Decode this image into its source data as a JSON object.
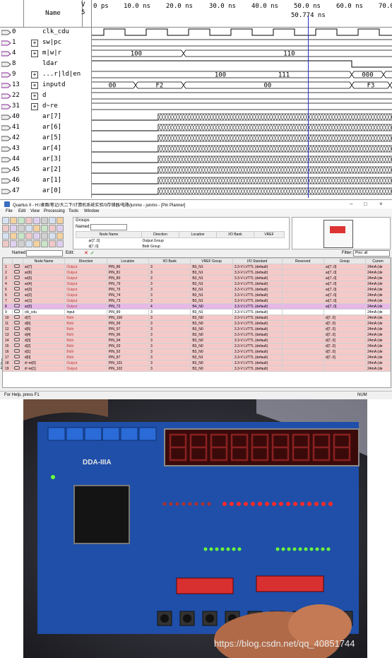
{
  "waveform": {
    "header": {
      "name_label": "Name",
      "value_label_1": "V",
      "value_label_2": "5"
    },
    "time_ticks": [
      "0 ps",
      "10.0 ns",
      "20.0 ns",
      "30.0 ns",
      "40.0 ns",
      "50.0 ns",
      "60.0 ns",
      "70.0"
    ],
    "cursor_label": "50.774 ns",
    "signals": [
      {
        "index": "0",
        "name": "clk_cdu",
        "expand": false,
        "values": []
      },
      {
        "index": "1",
        "name": "sw|pc",
        "expand": true,
        "values": []
      },
      {
        "index": "4",
        "name": "m|w|r",
        "expand": true,
        "values": [
          "100",
          "110"
        ]
      },
      {
        "index": "8",
        "name": "ldar",
        "expand": false,
        "values": []
      },
      {
        "index": "9",
        "name": "...r|ld|en",
        "expand": true,
        "values": [
          "100",
          "111",
          "000"
        ]
      },
      {
        "index": "13",
        "name": "inputd",
        "expand": true,
        "values": [
          "00",
          "F2",
          "00",
          "F3"
        ]
      },
      {
        "index": "22",
        "name": "d",
        "expand": true,
        "values": []
      },
      {
        "index": "31",
        "name": "d~re",
        "expand": true,
        "values": []
      },
      {
        "index": "40",
        "name": "ar[7]",
        "expand": false,
        "values": []
      },
      {
        "index": "41",
        "name": "ar[6]",
        "expand": false,
        "values": []
      },
      {
        "index": "42",
        "name": "ar[5]",
        "expand": false,
        "values": []
      },
      {
        "index": "43",
        "name": "ar[4]",
        "expand": false,
        "values": []
      },
      {
        "index": "44",
        "name": "ar[3]",
        "expand": false,
        "values": []
      },
      {
        "index": "45",
        "name": "ar[2]",
        "expand": false,
        "values": []
      },
      {
        "index": "46",
        "name": "ar[1]",
        "expand": false,
        "values": []
      },
      {
        "index": "47",
        "name": "ar[0]",
        "expand": false,
        "values": []
      }
    ]
  },
  "pin_planner": {
    "title": "Quartus II - H:/桌面/笔记/大二下/计算机系统实验/3存储器/电路/junmo - junmo - [Pin Planner]",
    "window_buttons": [
      "–",
      "□",
      "×"
    ],
    "menu": [
      "File",
      "Edit",
      "View",
      "Processing",
      "Tools",
      "Window"
    ],
    "groups_panel": {
      "title": "Groups",
      "named_label": "Named:",
      "columns": [
        "Node Name",
        "Direction",
        "Location",
        "I/O Bank",
        "VREF"
      ],
      "rows": [
        {
          "name": "ar[7..0]",
          "direction": "Output Group"
        },
        {
          "name": "d[7..0]",
          "direction": "Bidir Group"
        }
      ]
    },
    "filter_bar": {
      "named_label": "Named:",
      "edit_label": "Edit:",
      "filter_label": "Filter:",
      "filter_value": "Pins: all"
    },
    "columns": [
      "",
      "",
      "Node Name",
      "Direction",
      "Location",
      "I/O Bank",
      "VREF Group",
      "I/O Standard",
      "Reserved",
      "Group",
      "Curren"
    ],
    "rows": [
      [
        "1",
        "ar[7]",
        "Output",
        "PIN_86",
        "3",
        "B3_N1",
        "3.3-V LVTTL (default)",
        "",
        "ar[7..0]",
        "24mA (de"
      ],
      [
        "2",
        "ar[6]",
        "Output",
        "PIN_81",
        "3",
        "B3_N1",
        "3.3-V LVTTL (default)",
        "",
        "ar[7..0]",
        "24mA (de"
      ],
      [
        "3",
        "ar[5]",
        "Output",
        "PIN_80",
        "3",
        "B3_N1",
        "3.3-V LVTTL (default)",
        "",
        "ar[7..0]",
        "24mA (de"
      ],
      [
        "4",
        "ar[4]",
        "Output",
        "PIN_79",
        "3",
        "B3_N1",
        "3.3-V LVTTL (default)",
        "",
        "ar[7..0]",
        "24mA (de"
      ],
      [
        "5",
        "ar[3]",
        "Output",
        "PIN_75",
        "3",
        "B3_N1",
        "3.3-V LVTTL (default)",
        "",
        "ar[7..0]",
        "24mA (de"
      ],
      [
        "6",
        "ar[2]",
        "Output",
        "PIN_74",
        "3",
        "B3_N1",
        "3.3-V LVTTL (default)",
        "",
        "ar[7..0]",
        "24mA (de"
      ],
      [
        "7",
        "ar[1]",
        "Output",
        "PIN_73",
        "3",
        "B3_N1",
        "3.3-V LVTTL (default)",
        "",
        "ar[7..0]",
        "24mA (de"
      ],
      [
        "8",
        "ar[0]",
        "Output",
        "PIN_72",
        "4",
        "B4_N0",
        "3.3-V LVTTL (default)",
        "",
        "ar[7..0]",
        "24mA (de"
      ],
      [
        "9",
        "clk_cdu",
        "Input",
        "PIN_89",
        "3",
        "B3_N1",
        "3.3-V LVTTL (default)",
        "",
        "",
        "24mA (de"
      ],
      [
        "10",
        "d[7]",
        "Bidir",
        "PIN_100",
        "3",
        "B3_N0",
        "3.3-V LVTTL (default)",
        "",
        "d[7..0]",
        "24mA (de"
      ],
      [
        "11",
        "d[6]",
        "Bidir",
        "PIN_99",
        "3",
        "B3_N0",
        "3.3-V LVTTL (default)",
        "",
        "d[7..0]",
        "24mA (de"
      ],
      [
        "12",
        "d[5]",
        "Bidir",
        "PIN_97",
        "3",
        "B3_N0",
        "3.3-V LVTTL (default)",
        "",
        "d[7..0]",
        "24mA (de"
      ],
      [
        "13",
        "d[4]",
        "Bidir",
        "PIN_96",
        "3",
        "B3_N0",
        "3.3-V LVTTL (default)",
        "",
        "d[7..0]",
        "24mA (de"
      ],
      [
        "14",
        "d[3]",
        "Bidir",
        "PIN_94",
        "3",
        "B3_N0",
        "3.3-V LVTTL (default)",
        "",
        "d[7..0]",
        "24mA (de"
      ],
      [
        "15",
        "d[2]",
        "Bidir",
        "PIN_93",
        "3",
        "B3_N0",
        "3.3-V LVTTL (default)",
        "",
        "d[7..0]",
        "24mA (de"
      ],
      [
        "16",
        "d[1]",
        "Bidir",
        "PIN_92",
        "3",
        "B3_N0",
        "3.3-V LVTTL (default)",
        "",
        "d[7..0]",
        "24mA (de"
      ],
      [
        "17",
        "d[0]",
        "Bidir",
        "PIN_87",
        "3",
        "B3_N1",
        "3.3-V LVTTL (default)",
        "",
        "d[7..0]",
        "24mA (de"
      ],
      [
        "18",
        "d~re[0]",
        "Output",
        "PIN_101",
        "3",
        "B3_N0",
        "3.3-V LVTTL (default)",
        "",
        "",
        "24mA (de"
      ],
      [
        "19",
        "d~re[1]",
        "Output",
        "PIN_102",
        "3",
        "B3_N0",
        "3.3-V LVTTL (default)",
        "",
        "",
        "24mA (de"
      ]
    ],
    "side_label": "All Pins",
    "status": "For Help, press F1",
    "num_indicator": "NUM"
  },
  "photo": {
    "board_label": "DDA-IIIA",
    "watermark": "https://blog.csdn.net/qq_40851744"
  },
  "colors": {
    "cursor": "#2233cc",
    "row_output": "#f6c9c9",
    "row_selected": "#e6b8e6",
    "board_blue": "#1f4fa8",
    "led_red": "#ff2a2a",
    "led_green": "#6dff3a"
  }
}
